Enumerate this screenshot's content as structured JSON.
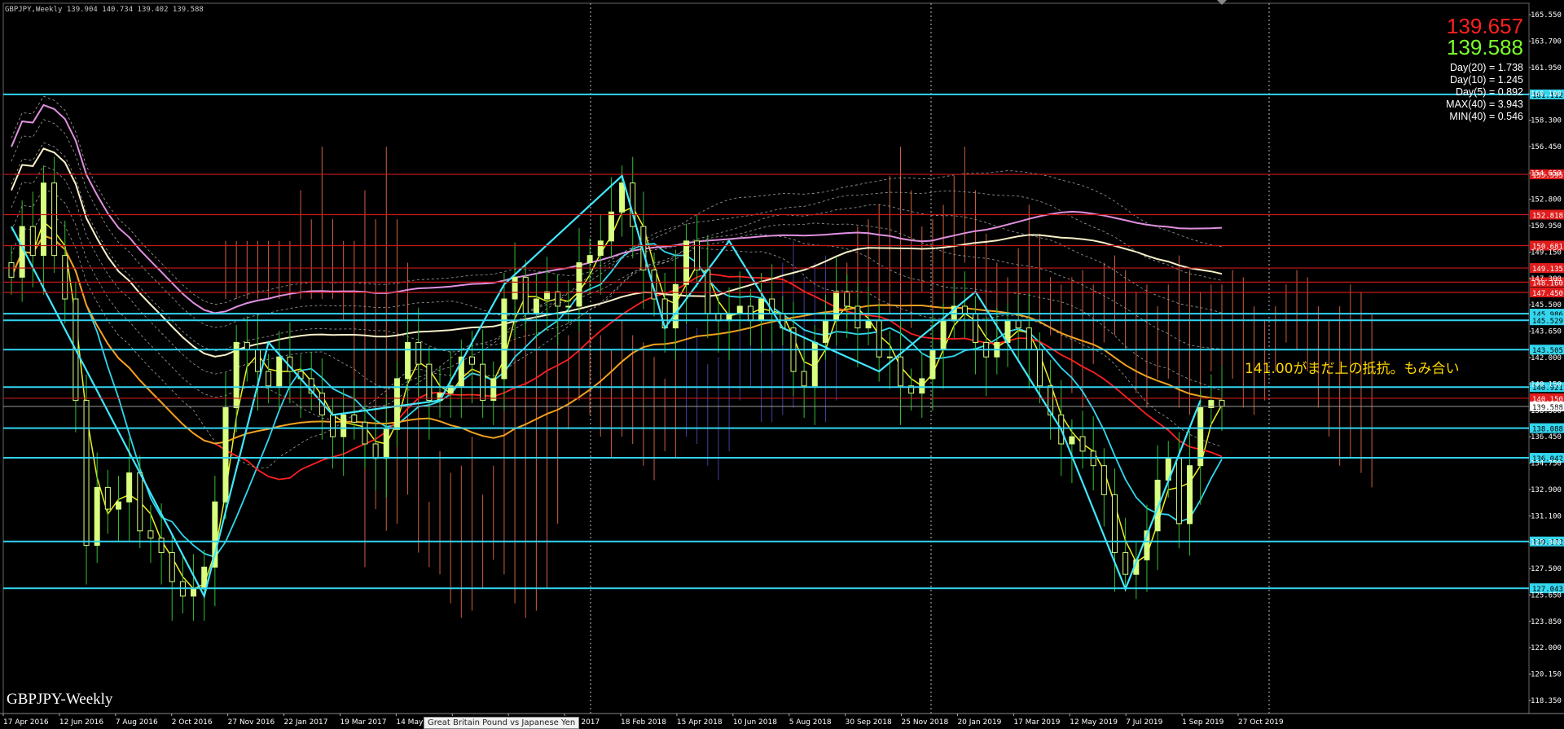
{
  "window": {
    "symbol_header": "GBPJPY,Weekly  139.904 140.734 139.402 139.588",
    "watermark": "GBPJPY-Weekly",
    "tooltip": "Great Britain Pound vs Japanese Yen",
    "bid": "139.657",
    "ask": "139.588",
    "stats": [
      "Day(20) = 1.738",
      "Day(10) = 1.245",
      "Day(5) = 0.892",
      "MAX(40) = 3.943",
      "MIN(40) = 0.546"
    ],
    "comment": "141.00がまだ上の抵抗。もみ合い"
  },
  "colors": {
    "background": "#000000",
    "axis_text": "#ffffff",
    "hline_cyan": "#32d4f0",
    "hline_red": "#c81818",
    "label_cyan_bg": "#33d6ee",
    "label_red_bg": "#e01c1c",
    "candle": "#d8ff80",
    "sma_yellow": "#f0f020",
    "sma_cyan": "#30d8f0",
    "sma_red": "#ff2020",
    "sma_orange": "#f0a020",
    "sma_white": "#f8f0c8",
    "sma_pink": "#e090e0",
    "zigzag": "#40e8ff",
    "cloud_up": "#d06040",
    "cloud_down": "#4040a0",
    "comment": "#ffd800"
  },
  "chart_data": {
    "type": "candlestick",
    "title": "GBPJPY-Weekly",
    "y_range": [
      118.4,
      167.4
    ],
    "y_ticks": [
      "165.550",
      "163.700",
      "161.950",
      "160.100",
      "158.300",
      "156.450",
      "154.650",
      "152.800",
      "150.950",
      "149.150",
      "147.300",
      "145.500",
      "143.650",
      "142.000",
      "140.150",
      "138.300",
      "136.450",
      "134.750",
      "132.900",
      "131.100",
      "129.300",
      "127.500",
      "125.650",
      "123.850",
      "122.000",
      "120.150",
      "118.350"
    ],
    "x_labels": [
      "17 Apr 2016",
      "12 Jun 2016",
      "7 Aug 2016",
      "2 Oct 2016",
      "27 Nov 2016",
      "22 Jan 2017",
      "19 Mar 2017",
      "14 May 2017",
      "",
      "",
      "Dec 2017",
      "18 Feb 2018",
      "15 Apr 2018",
      "10 Jun 2018",
      "5 Aug 2018",
      "30 Sep 2018",
      "25 Nov 2018",
      "20 Jan 2019",
      "17 Mar 2019",
      "12 May 2019",
      "7 Jul 2019",
      "1 Sep 2019",
      "27 Oct 2019"
    ],
    "level_lines": [
      {
        "price": 161.112,
        "label": "161.112",
        "color": "cyan"
      },
      {
        "price": 155.595,
        "label": "155.595",
        "color": "red"
      },
      {
        "price": 152.818,
        "label": "152.818",
        "color": "red"
      },
      {
        "price": 150.681,
        "label": "150.681",
        "color": "red"
      },
      {
        "price": 149.135,
        "label": "149.135",
        "color": "red"
      },
      {
        "price": 148.16,
        "label": "148.160",
        "color": "red"
      },
      {
        "price": 147.45,
        "label": "147.450",
        "color": "red"
      },
      {
        "price": 145.986,
        "label": "145.986",
        "color": "cyan"
      },
      {
        "price": 145.529,
        "label": "145.529",
        "color": "cyan"
      },
      {
        "price": 143.505,
        "label": "143.505",
        "color": "cyan"
      },
      {
        "price": 140.921,
        "label": "140.921",
        "color": "cyan"
      },
      {
        "price": 140.15,
        "label": "140.150",
        "color": "red"
      },
      {
        "price": 138.088,
        "label": "138.088",
        "color": "cyan"
      },
      {
        "price": 136.042,
        "label": "136.042",
        "color": "cyan"
      },
      {
        "price": 130.272,
        "label": "130.272",
        "color": "cyan"
      },
      {
        "price": 127.043,
        "label": "127.043",
        "color": "cyan"
      }
    ],
    "current_price": {
      "price": 139.588,
      "label": "139.588"
    },
    "close_series": [
      148.5,
      152.0,
      150.0,
      155.0,
      150.0,
      147.0,
      140.0,
      130.0,
      134.0,
      132.5,
      133.0,
      135.0,
      131.0,
      130.5,
      129.5,
      127.5,
      126.5,
      127.0,
      128.5,
      133.0,
      139.5,
      144.0,
      143.5,
      142.0,
      141.0,
      143.0,
      142.0,
      141.5,
      140.5,
      139.0,
      137.5,
      139.0,
      138.5,
      137.0,
      136.0,
      138.0,
      141.5,
      144.0,
      142.5,
      140.0,
      140.5,
      141.0,
      143.0,
      142.5,
      140.0,
      141.5,
      147.0,
      148.5,
      146.0,
      147.0,
      147.5,
      146.5,
      146.5,
      149.5,
      150.0,
      151.0,
      153.0,
      155.0,
      152.0,
      149.0,
      147.0,
      145.0,
      148.0,
      151.0,
      149.0,
      146.0,
      145.5,
      146.0,
      146.5,
      145.5,
      147.0,
      146.0,
      145.0,
      142.0,
      141.0,
      144.0,
      145.5,
      147.5,
      146.5,
      145.0,
      145.5,
      143.0,
      143.0,
      141.0,
      140.5,
      141.5,
      143.5,
      145.5,
      146.5,
      146.0,
      144.0,
      143.0,
      144.0,
      145.5,
      145.0,
      143.5,
      141.0,
      139.0,
      137.0,
      137.5,
      136.5,
      135.5,
      133.5,
      129.5,
      128.0,
      129.0,
      131.0,
      134.5,
      136.0,
      131.5,
      135.5,
      139.5,
      140.0,
      139.6
    ]
  }
}
